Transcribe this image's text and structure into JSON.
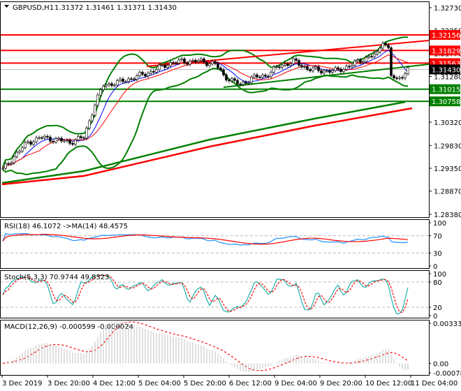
{
  "header": {
    "symbol": "GBPUSD,H1",
    "ohlc": "1.31372 1.31461 1.31371 1.31430"
  },
  "colors": {
    "resistance": "#ff0000",
    "support": "#008000",
    "current": "#000000",
    "rsi": "#1e90ff",
    "stoch_main": "#20b2aa",
    "signal": "#ff0000",
    "macd_hist": "#c0c0c0"
  },
  "chart_data": [
    {
      "type": "line",
      "title": "GBPUSD,H1",
      "ylim": [
        1.2838,
        1.3273
      ],
      "y_ticks": [
        "1.32730",
        "1.32250",
        "1.31770",
        "1.31280",
        "1.30320",
        "1.29830",
        "1.29350",
        "1.28870",
        "1.28380"
      ],
      "x_ticks": [
        "3 Dec 2019",
        "3 Dec 20:00",
        "4 Dec 12:00",
        "5 Dec 04:00",
        "5 Dec 20:00",
        "6 Dec 12:00",
        "9 Dec 04:00",
        "9 Dec 20:00",
        "10 Dec 12:00",
        "11 Dec 04:00"
      ],
      "price_keypoints": [
        [
          0,
          1.2932
        ],
        [
          4,
          1.296
        ],
        [
          9,
          1.299
        ],
        [
          14,
          1.3
        ],
        [
          19,
          1.2995
        ],
        [
          24,
          1.299
        ],
        [
          29,
          1.3
        ],
        [
          33,
          1.307
        ],
        [
          36,
          1.311
        ],
        [
          41,
          1.3115
        ],
        [
          49,
          1.313
        ],
        [
          54,
          1.314
        ],
        [
          59,
          1.3155
        ],
        [
          64,
          1.316
        ],
        [
          71,
          1.316
        ],
        [
          76,
          1.3155
        ],
        [
          79,
          1.313
        ],
        [
          85,
          1.311
        ],
        [
          89,
          1.3125
        ],
        [
          94,
          1.313
        ],
        [
          99,
          1.315
        ],
        [
          104,
          1.316
        ],
        [
          109,
          1.3145
        ],
        [
          114,
          1.314
        ],
        [
          119,
          1.314
        ],
        [
          124,
          1.315
        ],
        [
          129,
          1.3165
        ],
        [
          134,
          1.3175
        ],
        [
          136,
          1.3205
        ],
        [
          138,
          1.3185
        ],
        [
          139,
          1.313
        ],
        [
          141,
          1.312
        ],
        [
          145,
          1.3143
        ]
      ],
      "levels": [
        {
          "label": "1.32156",
          "value": 1.32156,
          "kind": "resistance"
        },
        {
          "label": "1.31829",
          "value": 1.31829,
          "kind": "resistance"
        },
        {
          "label": "1.31563",
          "value": 1.31563,
          "kind": "resistance"
        },
        {
          "label": "1.31430",
          "value": 1.3143,
          "kind": "current"
        },
        {
          "label": "1.31015",
          "value": 1.31015,
          "kind": "support"
        },
        {
          "label": "1.30758",
          "value": 1.30758,
          "kind": "support"
        }
      ]
    },
    {
      "type": "line",
      "title": "RSI(18) 46.1072  ->MA(14) 48.4575",
      "ylim": [
        0,
        100
      ],
      "y_ticks": [
        "100",
        "70",
        "30",
        "0"
      ],
      "levels": [
        70,
        30
      ]
    },
    {
      "type": "line",
      "title": "Stoch(5,3,3) 70.9744 49.8323",
      "ylim": [
        0,
        100
      ],
      "y_ticks": [
        "100",
        "80",
        "20",
        "0"
      ],
      "levels": [
        80,
        20
      ]
    },
    {
      "type": "bar",
      "title": "MACD(12,26,9) -0.000599 -0.000024",
      "ylim": [
        -0.000786,
        0.00333
      ],
      "y_ticks": [
        "0.00333",
        "0.00",
        "-0.000786"
      ]
    }
  ]
}
